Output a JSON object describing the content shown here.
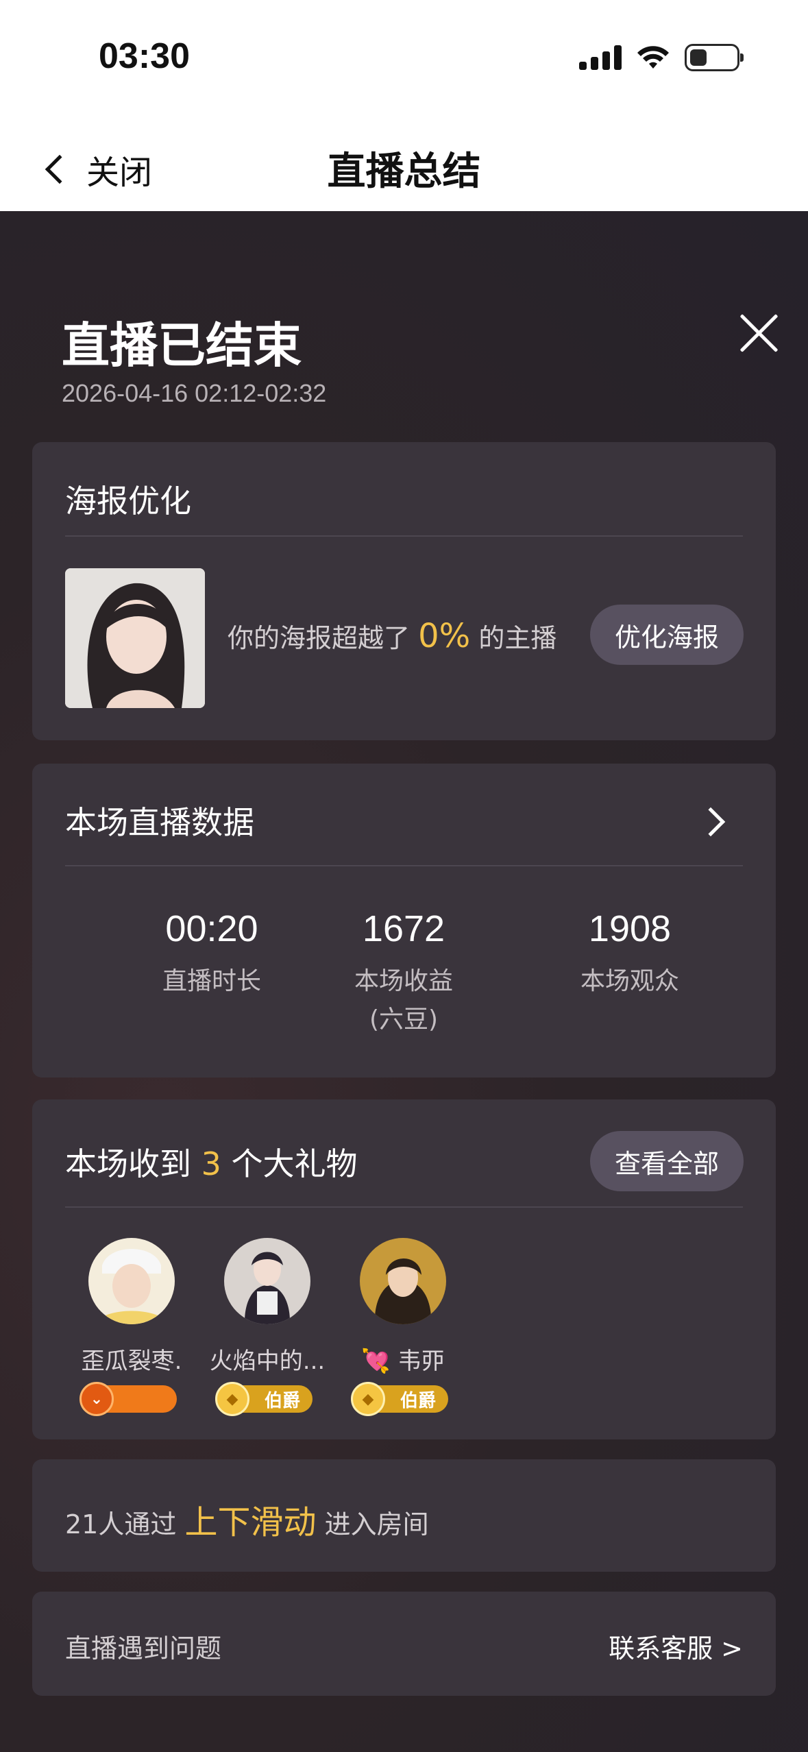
{
  "status_bar": {
    "time": "03:30"
  },
  "nav": {
    "back_label": "关闭",
    "title": "直播总结"
  },
  "header": {
    "title": "直播已结束",
    "date": "2026-04-16 02:12-02:32"
  },
  "poster": {
    "title": "海报优化",
    "text_before": "你的海报超越了",
    "percent": "0%",
    "text_after": "的主播",
    "button": "优化海报"
  },
  "stats": {
    "title": "本场直播数据",
    "items": [
      {
        "value": "00:20",
        "label": "直播时长",
        "sub": ""
      },
      {
        "value": "1672",
        "label": "本场收益",
        "sub": "(六豆)"
      },
      {
        "value": "1908",
        "label": "本场观众",
        "sub": ""
      }
    ]
  },
  "gifts": {
    "title_before": "本场收到",
    "count": "3",
    "title_after": "个大礼物",
    "button": "查看全部",
    "gifters": [
      {
        "name": "歪瓜裂枣.",
        "badge_text": "",
        "badge_style": "orange"
      },
      {
        "name": "火焰中的...",
        "badge_text": "伯爵",
        "badge_style": "gold"
      },
      {
        "name": "💘 韦丣",
        "badge_text": "伯爵",
        "badge_style": "gold"
      }
    ]
  },
  "swipe": {
    "text_before": "21人通过",
    "highlight": "上下滑动",
    "text_after": "进入房间"
  },
  "help": {
    "label": "直播遇到问题",
    "link": "联系客服 >"
  }
}
